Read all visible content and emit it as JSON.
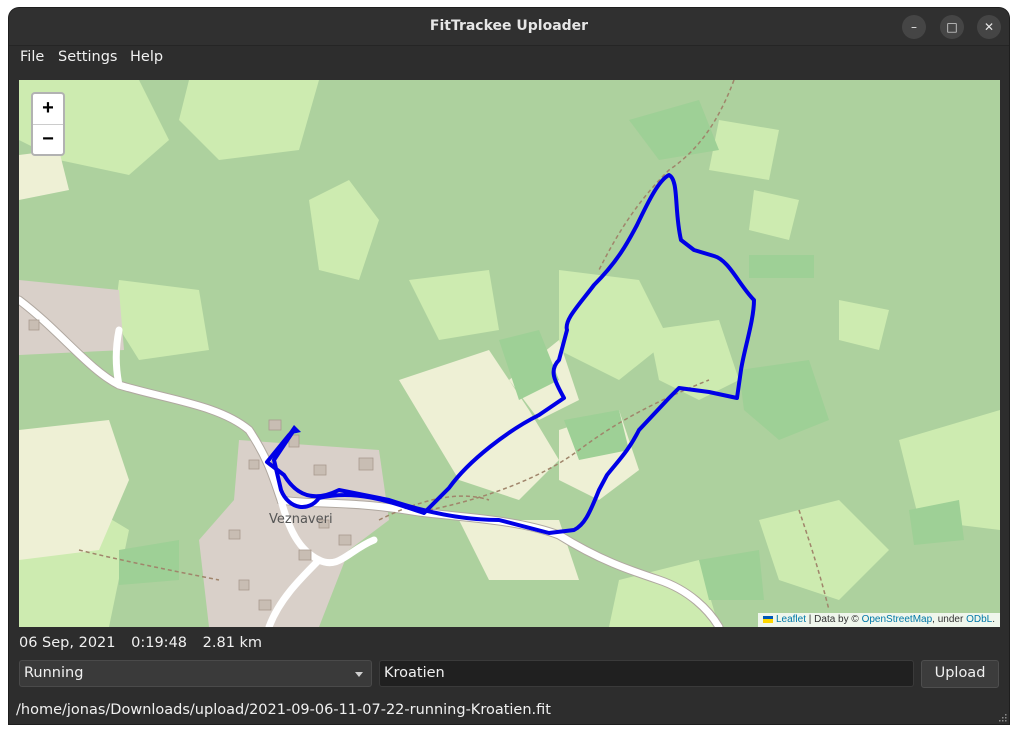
{
  "window": {
    "title": "FitTrackee Uploader",
    "controls": {
      "minimize": "–",
      "maximize": "□",
      "close": "✕"
    }
  },
  "menu": {
    "file": "File",
    "settings": "Settings",
    "help": "Help"
  },
  "map": {
    "zoom_in": "+",
    "zoom_out": "−",
    "place_label": "Veznaveri",
    "attribution": {
      "leaflet": "Leaflet",
      "data_by": "| Data by ©",
      "osm": "OpenStreetMap",
      "under": ", under",
      "odbl": "ODbL",
      "end": "."
    },
    "colors": {
      "forest": "#add19e",
      "meadow": "#cdebb0",
      "farmland": "#eef0d5",
      "track": "#0000e6",
      "road": "#ffffff",
      "built": "#d9d0c9"
    }
  },
  "activity": {
    "date": "06 Sep, 2021",
    "duration": "0:19:48",
    "distance": "2.81 km"
  },
  "form": {
    "sport": "Running",
    "title_value": "Kroatien",
    "upload_label": "Upload"
  },
  "status": {
    "file_path": "/home/jonas/Downloads/upload/2021-09-06-11-07-22-running-Kroatien.fit"
  }
}
